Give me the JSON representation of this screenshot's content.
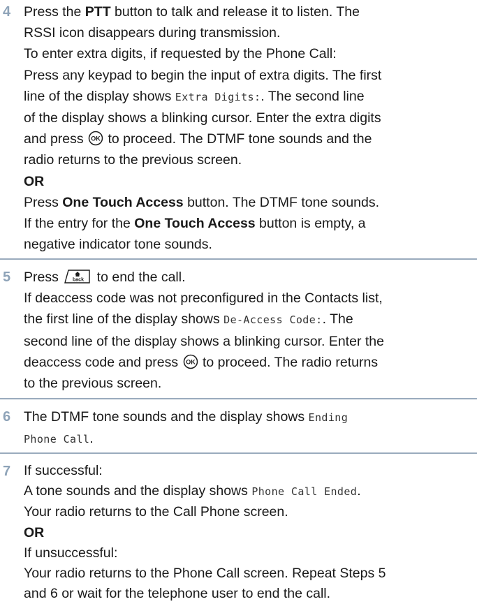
{
  "step4": {
    "number": "4",
    "l1a": "Press the ",
    "l1b": "PTT",
    "l1c": " button to talk and release it to listen. The",
    "l2": "RSSI icon disappears during transmission.",
    "l3": "To enter extra digits, if requested by the Phone Call:",
    "l4": "Press any keypad to begin the input of extra digits. The first",
    "l5a": "line of the display shows ",
    "l5b": "Extra Digits:",
    "l5c": ". The second line",
    "l6": "of the display shows a blinking cursor. Enter the extra digits",
    "l7a": "and press ",
    "l7b": " to proceed. The DTMF tone sounds and the",
    "l8": "radio returns to the previous screen.",
    "or": "OR",
    "l9a": "Press ",
    "l9b": "One Touch Access",
    "l9c": " button. The DTMF tone sounds.",
    "l10a": "If the entry for the ",
    "l10b": "One Touch Access",
    "l10c": " button is empty, a",
    "l11": "negative indicator tone sounds."
  },
  "step5": {
    "number": "5",
    "l1a": "Press ",
    "l1b": " to end the call.",
    "back_key_label": "back",
    "l2": "If deaccess code was not preconfigured in the Contacts list,",
    "l3a": "the first line of the display shows ",
    "l3b": "De-Access Code:",
    "l3c": ". The",
    "l4": "second line of the display shows a blinking cursor. Enter the",
    "l5a": "deaccess code and press ",
    "l5b": " to proceed. The radio returns",
    "l6": "to the previous screen."
  },
  "step6": {
    "number": "6",
    "l1a": "The DTMF tone sounds and the display shows ",
    "l1b": "Ending",
    "l2": "Phone Call",
    "l2c": "."
  },
  "step7": {
    "number": "7",
    "l1": "If successful:",
    "l2a": "A tone sounds and the display shows ",
    "l2b": "Phone Call Ended",
    "l2c": ".",
    "l3": "Your radio returns to the Call Phone screen.",
    "or": "OR",
    "l4": "If unsuccessful:",
    "l5": "Your radio returns to the Phone Call screen. Repeat Steps 5",
    "l6": "and 6 or wait for the telephone user to end the call."
  },
  "colors": {
    "step_number": "#8ea3b8",
    "separator": "#9aabbd",
    "text": "#1a1a1a"
  },
  "icons": {
    "ok": "ok-button-icon",
    "back": "back-home-key-icon"
  }
}
